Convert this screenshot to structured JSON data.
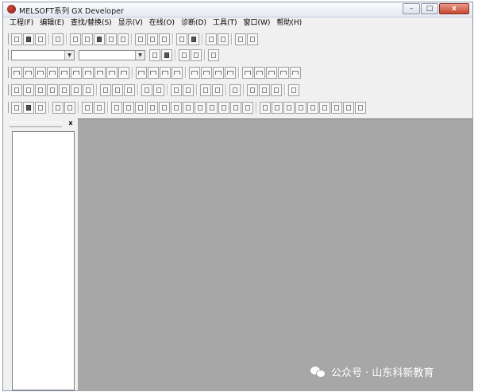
{
  "window": {
    "title": "MELSOFT系列 GX Developer",
    "controls": {
      "minimize": "–",
      "maximize": "□",
      "close": "x"
    }
  },
  "menubar": {
    "items": [
      "工程(F)",
      "编辑(E)",
      "查找/替换(S)",
      "显示(V)",
      "在线(O)",
      "诊断(D)",
      "工具(T)",
      "窗口(W)",
      "帮助(H)"
    ]
  },
  "side_panel": {
    "close_glyph": "x"
  },
  "watermark": {
    "text": "公众号 · 山东科新教育"
  }
}
